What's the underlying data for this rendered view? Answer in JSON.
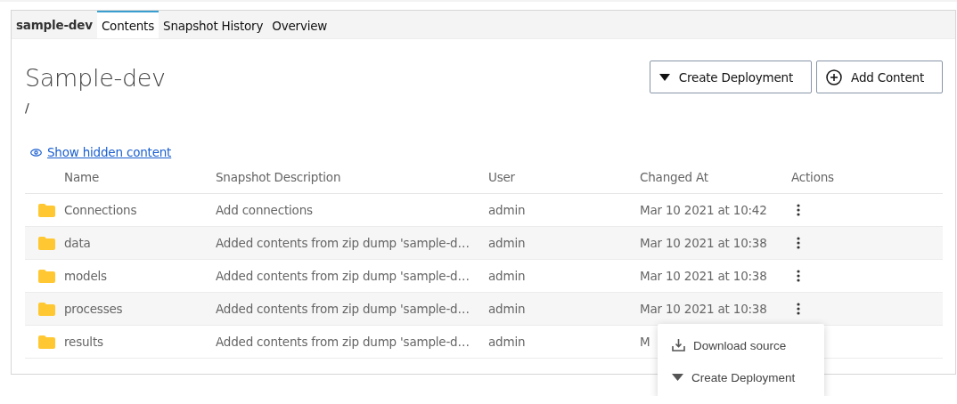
{
  "breadcrumb": "sample-dev",
  "tabs": [
    {
      "label": "Contents",
      "selected": true
    },
    {
      "label": "Snapshot History",
      "selected": false
    },
    {
      "label": "Overview",
      "selected": false
    }
  ],
  "title": "Sample-dev",
  "path": "/",
  "buttons": [
    {
      "label": "Create Deployment",
      "kind": "dropdown"
    },
    {
      "label": "Add Content",
      "kind": "add"
    }
  ],
  "hidden_link": "Show hidden content",
  "table": {
    "columns": [
      "Name",
      "Snapshot Description",
      "User",
      "Changed At",
      "Actions"
    ],
    "rows": [
      {
        "name": "Connections",
        "description": "Add connections",
        "user": "admin",
        "changed_at": "Mar 10 2021 at 10:42"
      },
      {
        "name": "data",
        "description": "Added contents from zip dump 'sample-d…",
        "user": "admin",
        "changed_at": "Mar 10 2021 at 10:38"
      },
      {
        "name": "models",
        "description": "Added contents from zip dump 'sample-d…",
        "user": "admin",
        "changed_at": "Mar 10 2021 at 10:38"
      },
      {
        "name": "processes",
        "description": "Added contents from zip dump 'sample-d…",
        "user": "admin",
        "changed_at": "Mar 10 2021 at 10:38",
        "action_menu": [
          {
            "label": "Download source",
            "kind": "download"
          },
          {
            "label": "Create Deployment",
            "kind": "deploy"
          }
        ]
      },
      {
        "name": "results",
        "description": "Added contents from zip dump 'sample-d…",
        "user": "admin",
        "changed_at": "M"
      }
    ]
  }
}
